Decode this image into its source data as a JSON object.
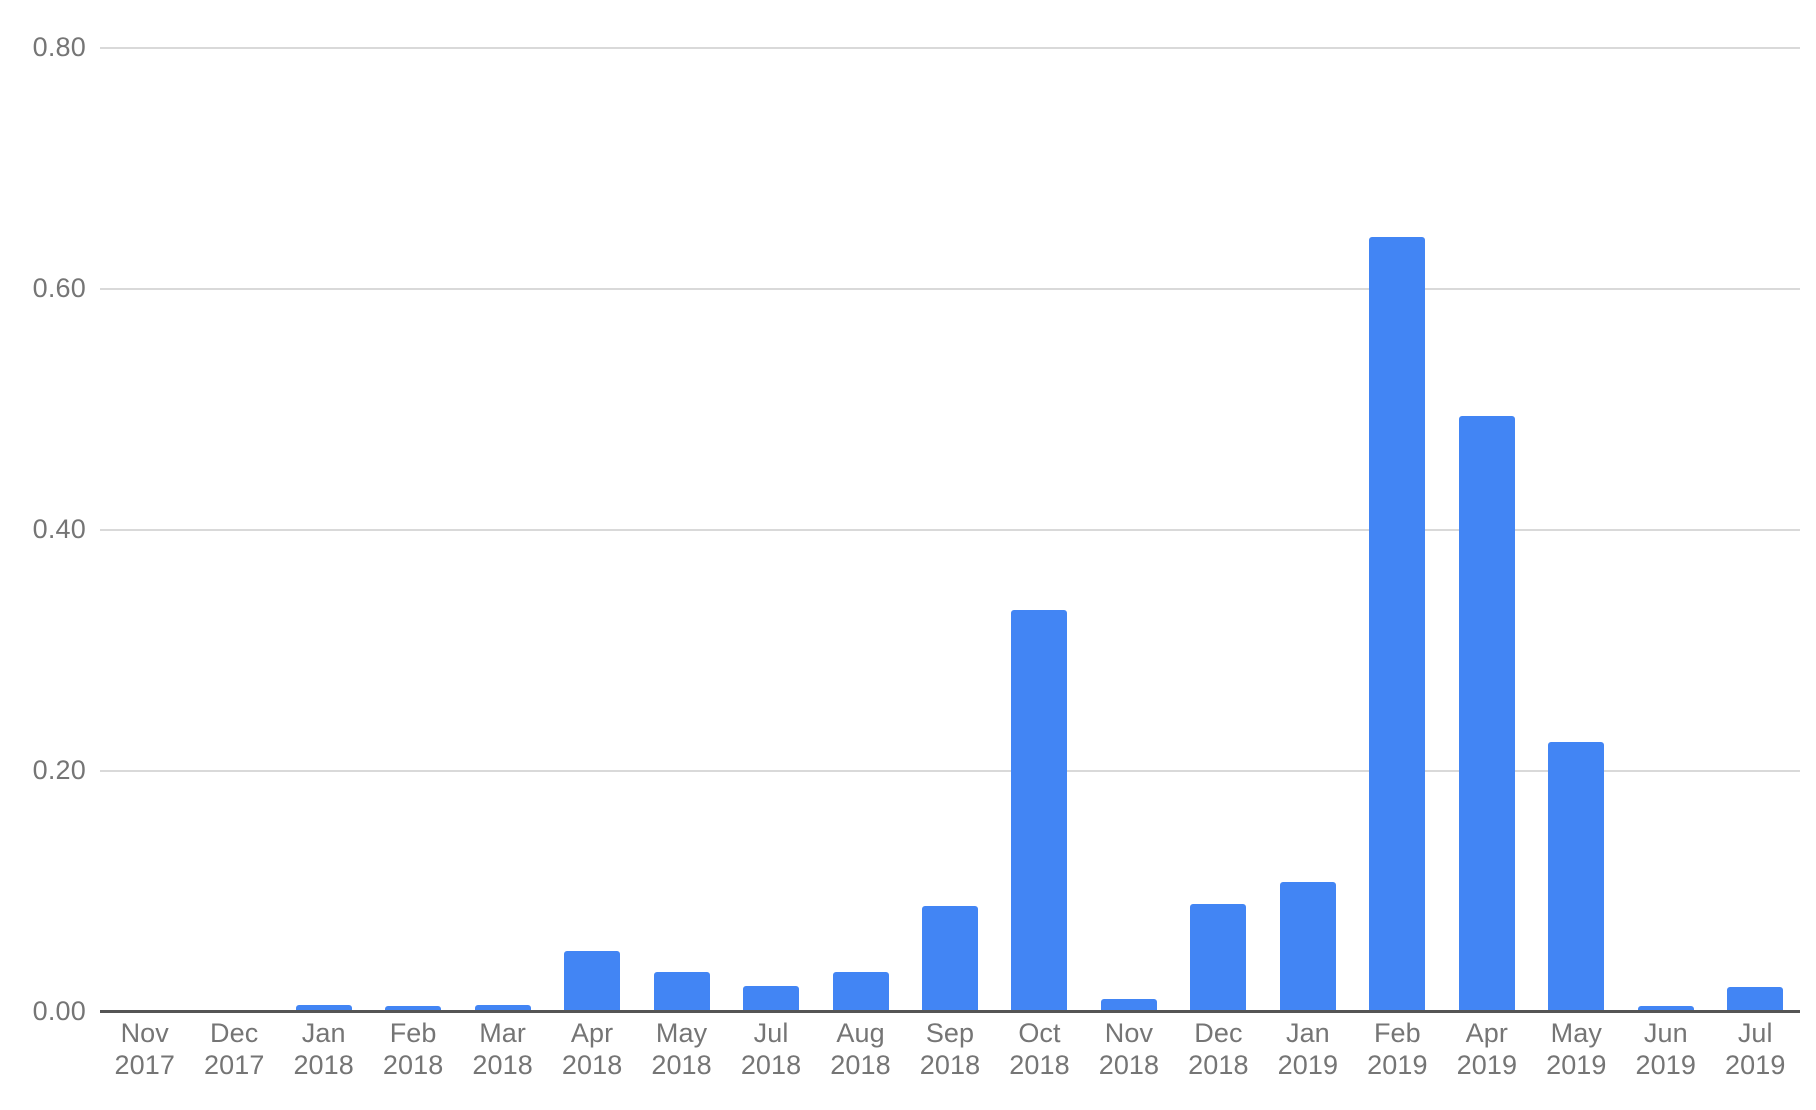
{
  "chart_data": {
    "type": "bar",
    "title": "",
    "subtitle": "",
    "xlabel": "",
    "ylabel": "",
    "grid": true,
    "legend": false,
    "legend_position": "none",
    "ylim": [
      0.0,
      0.8
    ],
    "y_ticks": [
      "0.00",
      "0.20",
      "0.40",
      "0.60",
      "0.80"
    ],
    "y_tick_values": [
      0.0,
      0.2,
      0.4,
      0.6,
      0.8
    ],
    "categories": [
      "Nov 2017",
      "Dec 2017",
      "Jan 2018",
      "Feb 2018",
      "Mar 2018",
      "Apr 2018",
      "May 2018",
      "Jul 2018",
      "Aug 2018",
      "Sep 2018",
      "Oct 2018",
      "Nov 2018",
      "Dec 2018",
      "Jan 2019",
      "Feb 2019",
      "Apr 2019",
      "May 2019",
      "Jun 2019",
      "Jul 2019"
    ],
    "category_months": [
      "Nov",
      "Dec",
      "Jan",
      "Feb",
      "Mar",
      "Apr",
      "May",
      "Jul",
      "Aug",
      "Sep",
      "Oct",
      "Nov",
      "Dec",
      "Jan",
      "Feb",
      "Apr",
      "May",
      "Jun",
      "Jul"
    ],
    "category_years": [
      "2017",
      "2017",
      "2018",
      "2018",
      "2018",
      "2018",
      "2018",
      "2018",
      "2018",
      "2018",
      "2018",
      "2018",
      "2018",
      "2019",
      "2019",
      "2019",
      "2019",
      "2019",
      "2019"
    ],
    "values": [
      0.0,
      0.0,
      0.006,
      0.005,
      0.006,
      0.051,
      0.033,
      0.022,
      0.033,
      0.088,
      0.334,
      0.011,
      0.09,
      0.108,
      0.643,
      0.495,
      0.224,
      0.005,
      0.021
    ],
    "series": [
      {
        "name": "",
        "color": "#4285f4",
        "values": [
          0.0,
          0.0,
          0.006,
          0.005,
          0.006,
          0.051,
          0.033,
          0.022,
          0.033,
          0.088,
          0.334,
          0.011,
          0.09,
          0.108,
          0.643,
          0.495,
          0.224,
          0.005,
          0.021
        ]
      }
    ]
  },
  "style": {
    "bar_color": "#4285f4",
    "gridline_color": "#d9d9d9",
    "axis_color": "#555555",
    "tick_label_color": "#757575",
    "background": "#ffffff"
  }
}
